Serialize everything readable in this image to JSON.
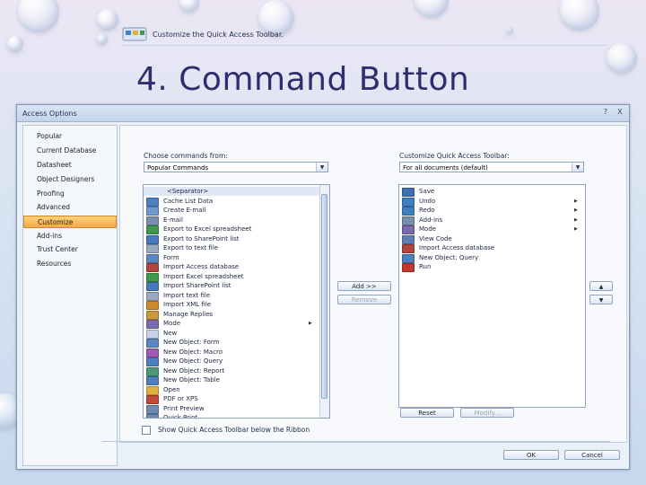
{
  "slide": {
    "title": "4. Command Button"
  },
  "dialog": {
    "title": "Access Options",
    "header_text": "Customize the Quick Access Toolbar.",
    "nav_items": [
      "Popular",
      "Current Database",
      "Datasheet",
      "Object Designers",
      "Proofing",
      "Advanced",
      "Customize",
      "Add-ins",
      "Trust Center",
      "Resources"
    ],
    "selected_nav": "Customize",
    "choose_label": "Choose commands from:",
    "choose_value": "Popular Commands",
    "customize_label": "Customize Quick Access Toolbar:",
    "customize_value": "For all documents (default)",
    "commands": [
      {
        "label": "<Separator>",
        "icon": "separator",
        "color": "#ffffff",
        "submenu": false
      },
      {
        "label": "Cache List Data",
        "icon": "table-icon",
        "color": "#4f7fc0",
        "submenu": false
      },
      {
        "label": "Create E-mail",
        "icon": "mail-icon",
        "color": "#6f9ad0",
        "submenu": false
      },
      {
        "label": "E-mail",
        "icon": "mail-icon",
        "color": "#7a8fb0",
        "submenu": false
      },
      {
        "label": "Export to Excel spreadsheet",
        "icon": "excel-icon",
        "color": "#3e9a4a",
        "submenu": false
      },
      {
        "label": "Export to SharePoint list",
        "icon": "sharepoint-icon",
        "color": "#4a78c0",
        "submenu": false
      },
      {
        "label": "Export to text file",
        "icon": "text-file-icon",
        "color": "#9aa8c0",
        "submenu": false
      },
      {
        "label": "Form",
        "icon": "form-icon",
        "color": "#5a86c4",
        "submenu": false
      },
      {
        "label": "Import Access database",
        "icon": "access-icon",
        "color": "#b0453a",
        "submenu": false
      },
      {
        "label": "Import Excel spreadsheet",
        "icon": "excel-icon",
        "color": "#3e9a4a",
        "submenu": false
      },
      {
        "label": "Import SharePoint list",
        "icon": "sharepoint-icon",
        "color": "#4a78c0",
        "submenu": false
      },
      {
        "label": "Import text file",
        "icon": "text-file-icon",
        "color": "#9aa8c0",
        "submenu": false
      },
      {
        "label": "Import XML file",
        "icon": "xml-icon",
        "color": "#d08a2c",
        "submenu": false
      },
      {
        "label": "Manage Replies",
        "icon": "replies-icon",
        "color": "#c99a3a",
        "submenu": false
      },
      {
        "label": "Mode",
        "icon": "mode-icon",
        "color": "#7a6bb0",
        "submenu": true
      },
      {
        "label": "New",
        "icon": "new-icon",
        "color": "#c6d2e6",
        "submenu": false
      },
      {
        "label": "New Object: Form",
        "icon": "form-icon",
        "color": "#5a86c4",
        "submenu": false
      },
      {
        "label": "New Object: Macro",
        "icon": "macro-icon",
        "color": "#a05ab0",
        "submenu": false
      },
      {
        "label": "New Object: Query",
        "icon": "query-icon",
        "color": "#4f7fc0",
        "submenu": false
      },
      {
        "label": "New Object: Report",
        "icon": "report-icon",
        "color": "#4a9a7a",
        "submenu": false
      },
      {
        "label": "New Object: Table",
        "icon": "table-icon",
        "color": "#4f7fc0",
        "submenu": false
      },
      {
        "label": "Open",
        "icon": "folder-icon",
        "color": "#e0b040",
        "submenu": false
      },
      {
        "label": "PDF or XPS",
        "icon": "pdf-icon",
        "color": "#c04a3a",
        "submenu": false
      },
      {
        "label": "Print Preview",
        "icon": "print-preview-icon",
        "color": "#6f8bb0",
        "submenu": false
      },
      {
        "label": "Quick Print",
        "icon": "print-icon",
        "color": "#6f8bb0",
        "submenu": false
      }
    ],
    "toolbar_items": [
      {
        "label": "Save",
        "icon": "save-icon",
        "color": "#3f6fb0",
        "submenu": false
      },
      {
        "label": "Undo",
        "icon": "undo-icon",
        "color": "#3f7fc0",
        "submenu": true
      },
      {
        "label": "Redo",
        "icon": "redo-icon",
        "color": "#3f7fc0",
        "submenu": true
      },
      {
        "label": "Add-ins",
        "icon": "add-ins-icon",
        "color": "#7a8fb0",
        "submenu": true
      },
      {
        "label": "Mode",
        "icon": "mode-icon",
        "color": "#7a6bb0",
        "submenu": true
      },
      {
        "label": "View Code",
        "icon": "code-icon",
        "color": "#5a7fb0",
        "submenu": false
      },
      {
        "label": "Import Access database",
        "icon": "access-icon",
        "color": "#b0453a",
        "submenu": false
      },
      {
        "label": "New Object: Query",
        "icon": "query-icon",
        "color": "#4f7fc0",
        "submenu": false
      },
      {
        "label": "Run",
        "icon": "run-icon",
        "color": "#c0392b",
        "submenu": false
      }
    ],
    "add_button": "Add >>",
    "remove_button": "Remove",
    "reset_button": "Reset",
    "modify_button": "Modify...",
    "move_up": "▲",
    "move_down": "▼",
    "show_below_label": "Show Quick Access Toolbar below the Ribbon",
    "ok_button": "OK",
    "cancel_button": "Cancel",
    "window_buttons": [
      "?",
      "X"
    ]
  }
}
